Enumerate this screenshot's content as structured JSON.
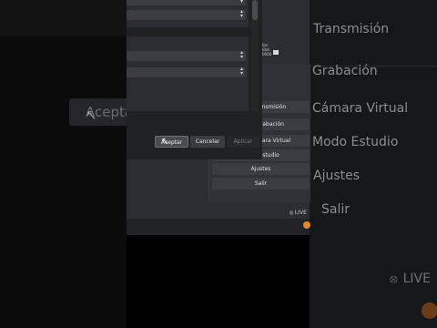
{
  "background_left": {
    "accept_label": "Acepta"
  },
  "background_right": {
    "menu": [
      {
        "label": "Transmisión"
      },
      {
        "label": "Grabación"
      },
      {
        "label": "Cámara Virtual"
      },
      {
        "label": "Modo Estudio"
      },
      {
        "label": "Ajustes"
      },
      {
        "label": "Salir"
      }
    ],
    "live_label": "LIVE"
  },
  "dock": {
    "buttons": [
      {
        "label": "Iniciar transmisión"
      },
      {
        "label": "Iniciar Grabación"
      },
      {
        "label": "Iniciar Cámara Virtual"
      },
      {
        "label": "Modo Estudio"
      },
      {
        "label": "Ajustes"
      },
      {
        "label": "Salir"
      }
    ],
    "live_label": "LIVE",
    "stats_lines": [
      "fps",
      "kb/s",
      "0000"
    ]
  },
  "dialog": {
    "accept_label": "Aceptar",
    "cancel_label": "Cancelar",
    "apply_label": "Aplicar"
  },
  "colors": {
    "accent_orange": "#e08a2a",
    "dialog_bg": "#202125",
    "button_bg": "#3a3c42"
  }
}
